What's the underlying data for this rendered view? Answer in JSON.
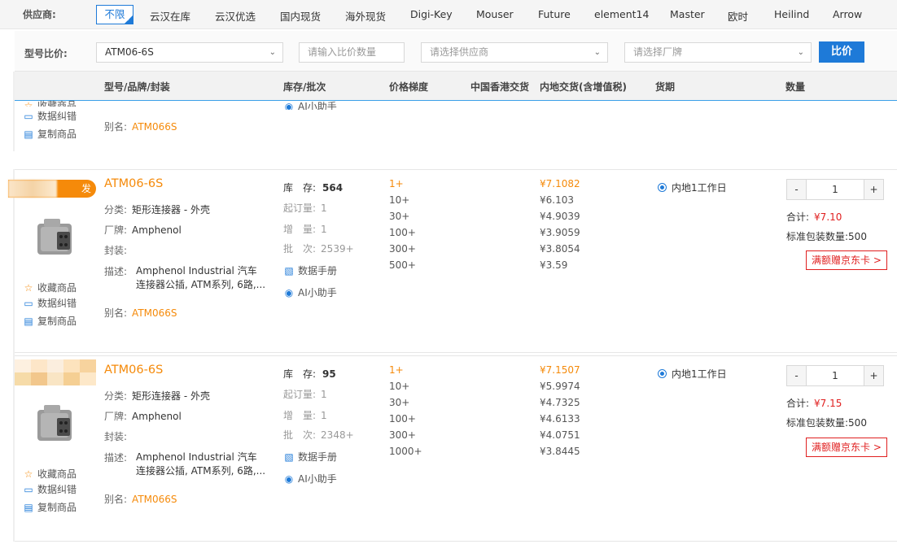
{
  "supplier_bar": {
    "label": "供应商:",
    "options": [
      "不限",
      "云汉在库",
      "云汉优选",
      "国内现货",
      "海外现货",
      "Digi-Key",
      "Mouser",
      "Future",
      "element14",
      "Master",
      "欧时",
      "Heilind",
      "Arrow"
    ],
    "active_index": 0
  },
  "compare_bar": {
    "label": "型号比价:",
    "model_value": "ATM06-6S",
    "qty_placeholder": "请输入比价数量",
    "supplier_placeholder": "请选择供应商",
    "brand_placeholder": "请选择厂牌",
    "button_label": "比价"
  },
  "table_header": {
    "model": "型号/品牌/封装",
    "stock": "库存/批次",
    "tiers": "价格梯度",
    "hk": "中国香港交货",
    "mainland": "内地交货(含增值税)",
    "lead": "货期",
    "qty": "数量"
  },
  "labels": {
    "favorite": "收藏商品",
    "report": "数据纠错",
    "copy": "复制商品",
    "category": "分类:",
    "brand": "厂牌:",
    "package": "封装:",
    "description": "描述:",
    "alias": "别名:",
    "stock": "库　存:",
    "moq": "起订量:",
    "increment": "增　量:",
    "batch": "批　次:",
    "datasheet": "数据手册",
    "ai": "AI小助手",
    "total": "合计:",
    "pack": "标准包装数量:",
    "promo": "满额赠京东卡 >",
    "minus": "-",
    "plus": "+"
  },
  "partial_row": {
    "alias": "ATM066S"
  },
  "products": [
    {
      "badge": "发",
      "name": "ATM06-6S",
      "category": "矩形连接器 - 外壳",
      "brand": "Amphenol",
      "package": "",
      "description": "Amphenol Industrial 汽车连接器公插, ATM系列, 6路,...",
      "alias": "ATM066S",
      "stock": "564",
      "moq": "1",
      "increment": "1",
      "batch": "2539+",
      "tiers": [
        "1+",
        "10+",
        "30+",
        "100+",
        "300+",
        "500+"
      ],
      "prices": [
        "¥7.1082",
        "¥6.103",
        "¥4.9039",
        "¥3.9059",
        "¥3.8054",
        "¥3.59"
      ],
      "lead": "内地1工作日",
      "qty": "1",
      "total": "¥7.10",
      "pack": "500"
    },
    {
      "badge": "",
      "name": "ATM06-6S",
      "category": "矩形连接器 - 外壳",
      "brand": "Amphenol",
      "package": "",
      "description": "Amphenol Industrial 汽车连接器公插, ATM系列, 6路,...",
      "alias": "ATM066S",
      "stock": "95",
      "moq": "1",
      "increment": "1",
      "batch": "2348+",
      "tiers": [
        "1+",
        "10+",
        "30+",
        "100+",
        "300+",
        "1000+"
      ],
      "prices": [
        "¥7.1507",
        "¥5.9974",
        "¥4.7325",
        "¥4.6133",
        "¥4.0751",
        "¥3.8445"
      ],
      "lead": "内地1工作日",
      "qty": "1",
      "total": "¥7.15",
      "pack": "500"
    }
  ],
  "colors": {
    "accent": "#1e7ad8",
    "orange": "#f58a0a",
    "red": "#e02020"
  }
}
